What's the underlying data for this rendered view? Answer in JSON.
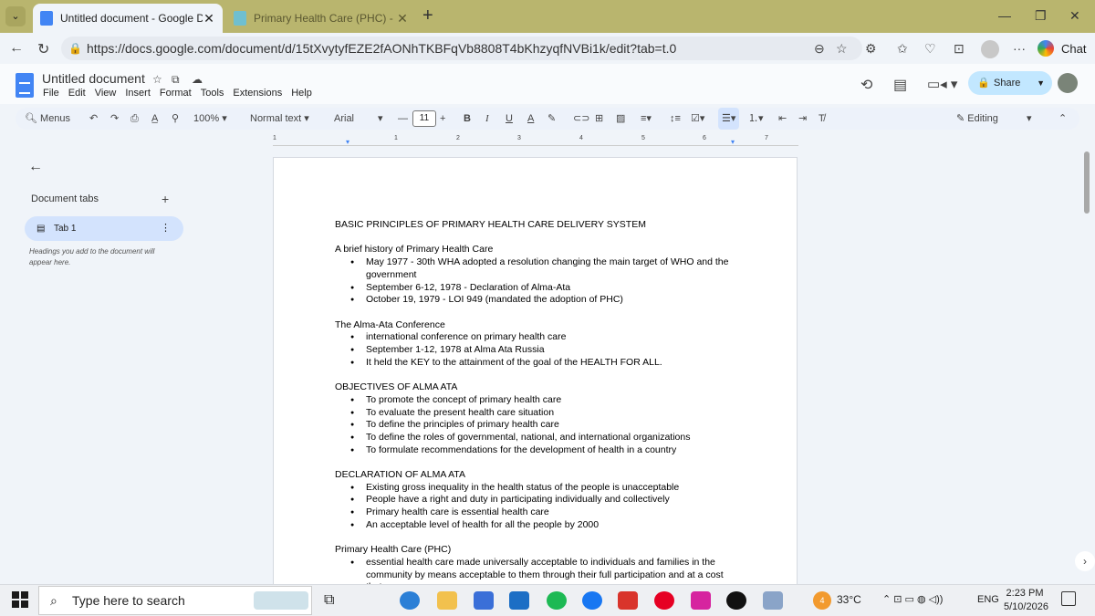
{
  "browser": {
    "tabs": [
      {
        "title": "Untitled document - Google Docs",
        "active": true
      },
      {
        "title": "Primary Health Care (PHC) - RNpe",
        "active": false
      }
    ],
    "url": "https://docs.google.com/document/d/15tXvytyfEZE2fAONhTKBFqVb8808T4bKhzyqfNVBi1k/edit?tab=t.0",
    "chat_label": "Chat"
  },
  "docs": {
    "title": "Untitled document",
    "menu": [
      "File",
      "Edit",
      "View",
      "Insert",
      "Format",
      "Tools",
      "Extensions",
      "Help"
    ],
    "share_label": "Share",
    "toolbar": {
      "menus": "Menus",
      "zoom": "100%",
      "style": "Normal text",
      "font": "Arial",
      "font_size": "11",
      "mode": "Editing"
    },
    "ruler_numbers": [
      "1",
      "1",
      "2",
      "3",
      "4",
      "5",
      "6",
      "7"
    ]
  },
  "sidebar": {
    "heading": "Document tabs",
    "tab_label": "Tab 1",
    "hint": "Headings you add to the document will appear here."
  },
  "document": {
    "title": "BASIC PRINCIPLES OF PRIMARY HEALTH CARE DELIVERY SYSTEM",
    "sections": [
      {
        "heading": "A brief history of Primary Health Care",
        "items": [
          "May 1977 - 30th WHA adopted a resolution changing the main target of WHO and the government",
          "September 6-12, 1978 - Declaration of Alma-Ata",
          "October 19, 1979 - LOI 949 (mandated the adoption of PHC)"
        ]
      },
      {
        "heading": "The Alma-Ata Conference",
        "items": [
          "international conference on primary health care",
          "September 1-12, 1978 at Alma Ata Russia",
          "It held the KEY to the attainment of the goal of the HEALTH FOR ALL."
        ]
      },
      {
        "heading": "OBJECTIVES OF ALMA ATA",
        "items": [
          "To promote the concept of primary health care",
          "To evaluate the present health care situation",
          "To define the principles of primary health care",
          "To define the roles of governmental, national, and international organizations",
          "To formulate recommendations for the development of health in a country"
        ]
      },
      {
        "heading": "DECLARATION OF ALMA ATA",
        "items": [
          "Existing gross inequality in the health status of the people is unacceptable",
          "People have a right and duty in participating individually and collectively",
          "Primary health care is essential health care",
          "An acceptable level of health for all the people by 2000"
        ]
      },
      {
        "heading": "Primary Health Care (PHC)",
        "items": [
          "essential health care made universally acceptable to individuals and families in the community by means acceptable to them through their full participation and at a cost that"
        ]
      }
    ]
  },
  "taskbar": {
    "search_placeholder": "Type here to search",
    "temperature": "33°C",
    "weather_badge": "4",
    "language": "ENG",
    "time": "2:23 PM",
    "date": "5/10/2026"
  },
  "colors": {
    "tabbar": "#b9b56e",
    "share_bg": "#c2e7ff",
    "docs_blue": "#4285f4",
    "sidebar_tab_bg": "#d3e3fd"
  }
}
